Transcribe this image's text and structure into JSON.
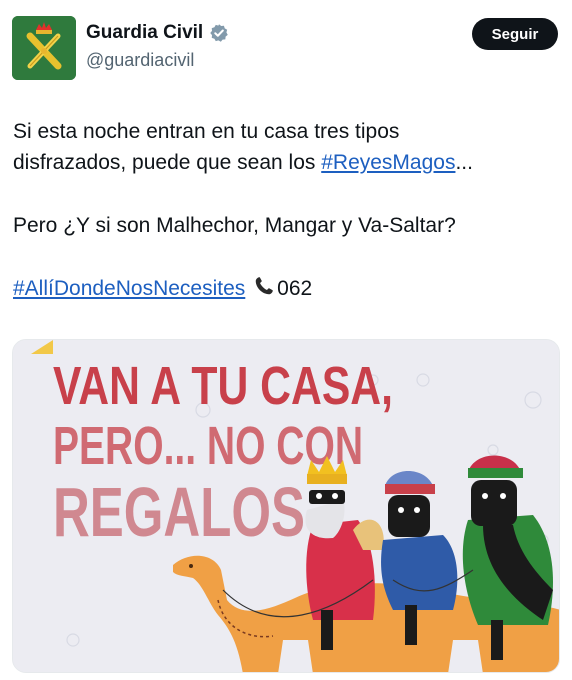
{
  "account": {
    "name": "Guardia Civil",
    "handle": "@guardiacivil",
    "verified": true,
    "follow_label": "Seguir",
    "avatar_icon": "guardia-civil-emblem-icon"
  },
  "tweet": {
    "line1_pre": "Si esta noche entran en tu casa tres tipos",
    "line2_pre": "disfrazados, puede que sean los ",
    "hashtag1": "#ReyesMagos",
    "line2_post": "...",
    "line3": "Pero ¿Y si son Malhechor, Mangar y Va-Saltar?",
    "hashtag2": "#AllíDondeNosNecesites",
    "phone_icon": "telephone-icon",
    "phone_number": "062"
  },
  "image": {
    "headline1": "VAN A TU CASA,",
    "headline2": "PERO... NO CON",
    "headline3": "REGALOS",
    "colors": {
      "headline": "#c8404a",
      "background": "#ececf2",
      "camel": "#f0a045",
      "king_red": "#d8304a",
      "king_blue": "#2f5ba8",
      "king_green": "#2f8a3a"
    }
  },
  "colors": {
    "link": "#1d5fc0",
    "avatar_bg": "#2f7a3d",
    "verified": "#829aab"
  }
}
